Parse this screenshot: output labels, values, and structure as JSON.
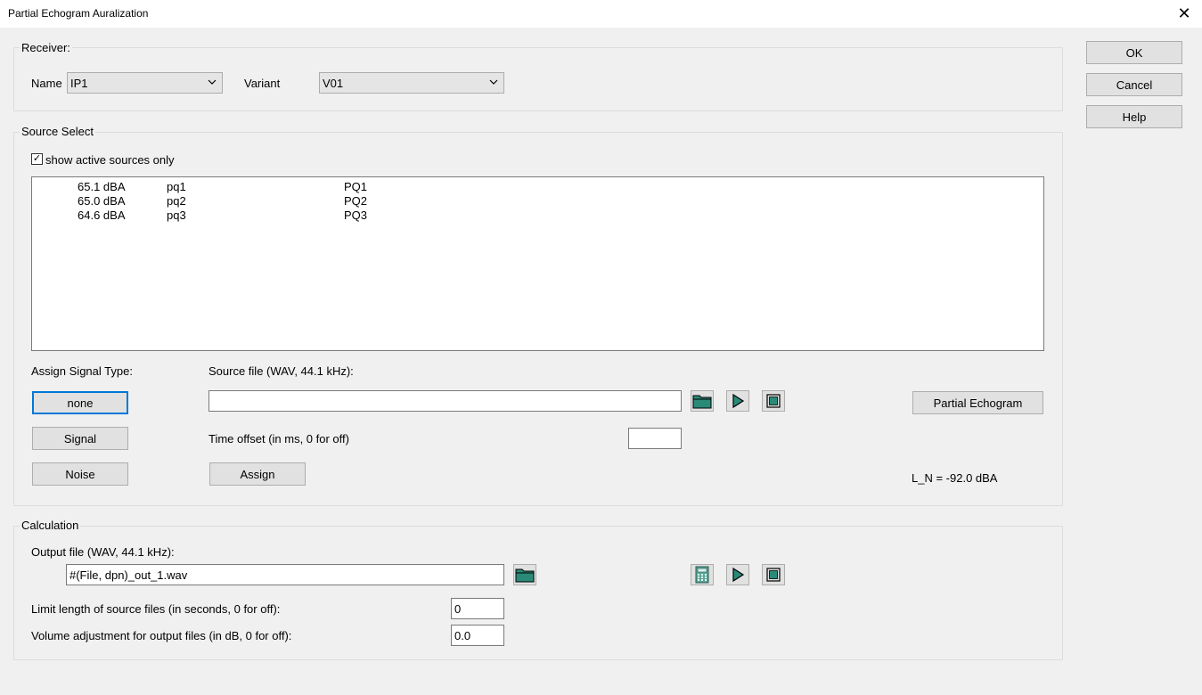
{
  "window": {
    "title": "Partial Echogram Auralization",
    "close_glyph": "✕"
  },
  "dialog_buttons": {
    "ok": "OK",
    "cancel": "Cancel",
    "help": "Help"
  },
  "receiver": {
    "legend": "Receiver:",
    "name_label": "Name",
    "name_value": "IP1",
    "variant_label": "Variant",
    "variant_value": "V01"
  },
  "source_select": {
    "legend": "Source Select",
    "show_active_label": "show active sources only",
    "show_active_checked": true,
    "sources": [
      {
        "level": "65.1 dBA",
        "id": "pq1",
        "name": "PQ1"
      },
      {
        "level": "65.0 dBA",
        "id": "pq2",
        "name": "PQ2"
      },
      {
        "level": "64.6 dBA",
        "id": "pq3",
        "name": "PQ3"
      }
    ],
    "assign_signal_type_label": "Assign Signal Type:",
    "btn_none": "none",
    "btn_signal": "Signal",
    "btn_noise": "Noise",
    "source_file_label": "Source file (WAV, 44.1 kHz):",
    "source_file_value": "",
    "time_offset_label": "Time offset (in ms, 0 for off)",
    "time_offset_value": "",
    "btn_assign": "Assign",
    "btn_partial_echogram": "Partial Echogram",
    "ln_readout": "L_N = -92.0 dBA"
  },
  "calculation": {
    "legend": "Calculation",
    "output_file_label": "Output file (WAV, 44.1 kHz):",
    "output_file_value": "#(File, dpn)_out_1.wav",
    "limit_length_label": "Limit length of source files (in seconds, 0 for off):",
    "limit_length_value": "0",
    "volume_adjust_label": "Volume adjustment for output files (in dB, 0 for off):",
    "volume_adjust_value": "0.0"
  },
  "icons": {
    "folder_color": "#1a7a6a",
    "play_color": "#1a7a6a",
    "stop_color": "#1a7a6a"
  }
}
